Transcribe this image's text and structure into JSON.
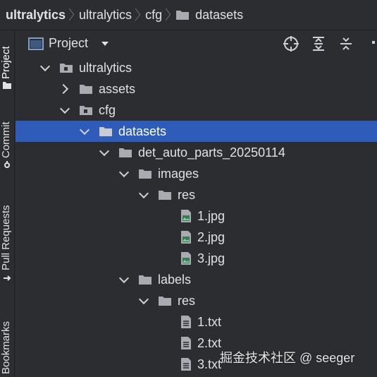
{
  "breadcrumb": {
    "items": [
      "ultralytics",
      "ultralytics",
      "cfg",
      "datasets"
    ]
  },
  "side_tabs": [
    "Project",
    "Commit",
    "Pull Requests",
    "Bookmarks"
  ],
  "panel": {
    "title": "Project",
    "tools": [
      "locate-icon",
      "expand-all-icon",
      "collapse-all-icon"
    ]
  },
  "tree": {
    "nodes": [
      {
        "label": "ultralytics",
        "type": "module-folder",
        "expanded": true
      },
      {
        "label": "assets",
        "type": "folder",
        "expanded": false
      },
      {
        "label": "cfg",
        "type": "module-folder",
        "expanded": true
      },
      {
        "label": "datasets",
        "type": "folder",
        "expanded": true,
        "selected": true
      },
      {
        "label": "det_auto_parts_20250114",
        "type": "folder",
        "expanded": true
      },
      {
        "label": "images",
        "type": "folder",
        "expanded": true
      },
      {
        "label": "res",
        "type": "folder",
        "expanded": true
      },
      {
        "label": "1.jpg",
        "type": "image-file"
      },
      {
        "label": "2.jpg",
        "type": "image-file"
      },
      {
        "label": "3.jpg",
        "type": "image-file"
      },
      {
        "label": "labels",
        "type": "folder",
        "expanded": true
      },
      {
        "label": "res",
        "type": "folder",
        "expanded": true
      },
      {
        "label": "1.txt",
        "type": "text-file"
      },
      {
        "label": "2.txt",
        "type": "text-file"
      },
      {
        "label": "3.txt",
        "type": "text-file"
      }
    ]
  },
  "watermark": "掘金技术社区 @ seeger",
  "colors": {
    "background": "#2b2d30",
    "selection": "#2e5cb8",
    "text": "#dfe1e5",
    "folder_icon": "#a9abb0"
  }
}
